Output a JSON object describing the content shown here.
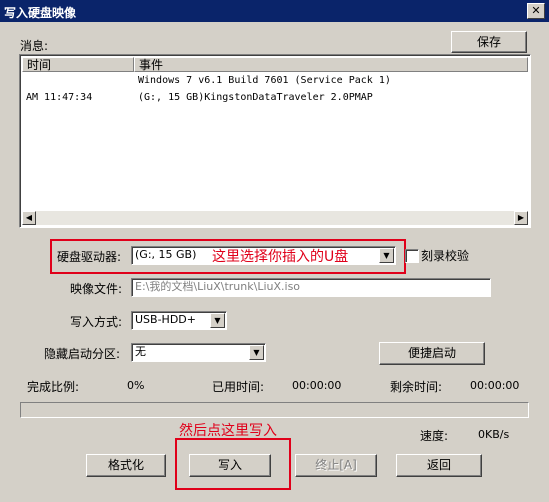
{
  "window": {
    "title": "写入硬盘映像",
    "close_glyph": "✕"
  },
  "messages": {
    "label": "消息:",
    "save_label": "保存",
    "columns": [
      "时间",
      "事件"
    ],
    "rows": [
      {
        "time": "",
        "event": "Windows 7 v6.1 Build 7601 (Service Pack 1)"
      },
      {
        "time": "AM 11:47:34",
        "event": "(G:, 15 GB)KingstonDataTraveler 2.0PMAP"
      }
    ]
  },
  "drive": {
    "label": "硬盘驱动器:",
    "value": "(G:, 15 GB)",
    "annotation": "这里选择你插入的U盘"
  },
  "verify": {
    "label": "刻录校验",
    "checked": false
  },
  "image_file": {
    "label": "映像文件:",
    "value": "E:\\我的文档\\LiuX\\trunk\\LiuX.iso"
  },
  "write_mode": {
    "label": "写入方式:",
    "value": "USB-HDD+"
  },
  "hide_partition": {
    "label": "隐藏启动分区:",
    "value": "无"
  },
  "quick_boot_label": "便捷启动",
  "status": {
    "ratio_label": "完成比例:",
    "ratio_value": "0%",
    "elapsed_label": "已用时间:",
    "elapsed_value": "00:00:00",
    "remaining_label": "剩余时间:",
    "remaining_value": "00:00:00",
    "speed_label": "速度:",
    "speed_value": "0KB/s",
    "progress": 0
  },
  "write_annotation": "然后点这里写入",
  "buttons": {
    "format": "格式化",
    "write": "写入",
    "stop": "终止[A]",
    "back": "返回"
  },
  "colors": {
    "title_bar": "#0a246a",
    "annotation": "#e0001a",
    "dialog_bg": "#d4d0c8"
  }
}
